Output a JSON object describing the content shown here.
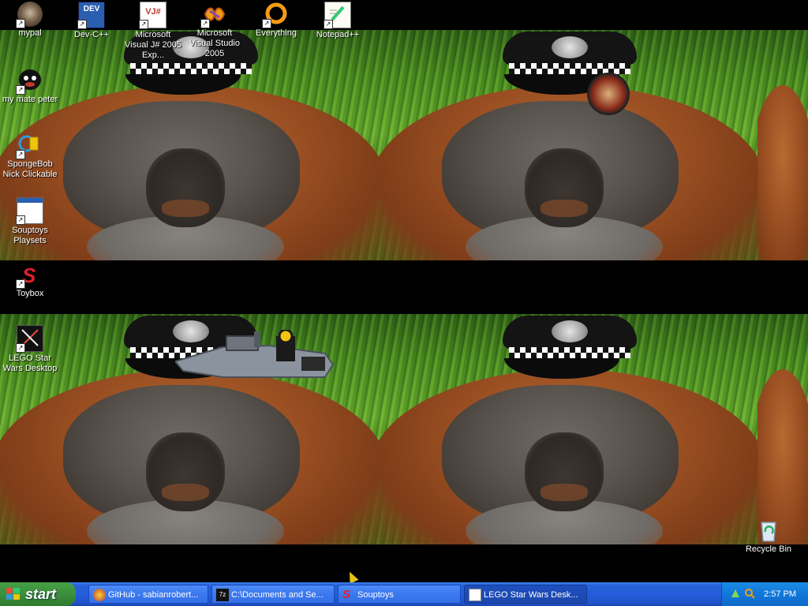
{
  "desktop_icons": {
    "mypal": "mypal",
    "devcpp": "Dev-C++",
    "vj_express": "Microsoft Visual J# 2005 Exp...",
    "vs2005": "Microsoft Visual Studio 2005",
    "everything": "Everything",
    "notepadpp": "Notepad++",
    "my_mate_peter": "my mate peter",
    "spongebob": "SpongeBob Nick Clickable",
    "souptoys_playsets": "Souptoys Playsets",
    "toybox": "Toybox",
    "lego_star_wars": "LEGO Star Wars Desktop",
    "recycle_bin": "Recycle Bin"
  },
  "taskbar": {
    "start_label": "start",
    "tasks": [
      {
        "label": "GitHub - sabianrobert..."
      },
      {
        "label": "C:\\Documents and Se..."
      },
      {
        "label": "Souptoys"
      },
      {
        "label": "LEGO Star Wars Desk..."
      }
    ],
    "clock": "2:57 PM"
  },
  "icon_text": {
    "devcpp_badge": "DEV",
    "vj_badge": "VJ#"
  },
  "colors": {
    "taskbar": "#245ddb",
    "start_button": "#3b8f3b",
    "tray": "#1277d9"
  },
  "icons": [
    "mypal-icon",
    "devcpp-icon",
    "vj-icon",
    "vs2005-icon",
    "everything-icon",
    "notepadpp-icon",
    "peter-icon",
    "spongebob-icon",
    "souptoys-icon",
    "toybox-icon",
    "lego-icon",
    "recycle-bin-icon",
    "windows-flag-icon",
    "network-icon",
    "search-tray-icon"
  ]
}
